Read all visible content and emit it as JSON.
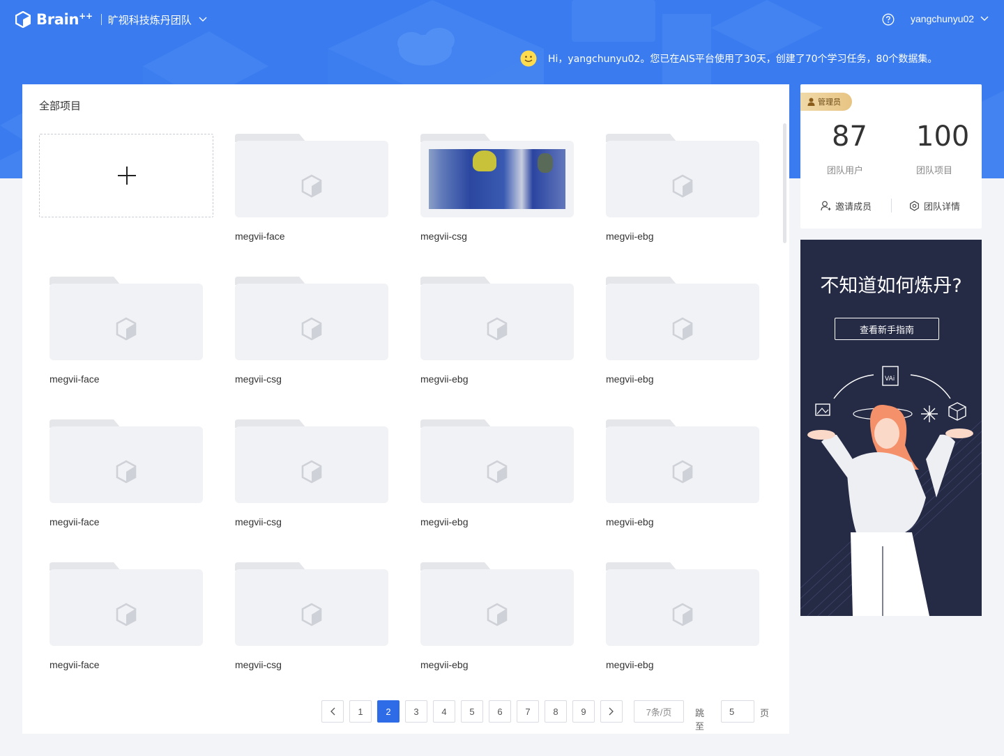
{
  "header": {
    "brand": "Brain",
    "brand_sup": "++",
    "team_name": "旷视科技炼丹团队",
    "username": "yangchunyu02",
    "greeting": "Hi，yangchunyu02。您已在AIS平台使用了30天，创建了70个学习任务，80个数据集。"
  },
  "main": {
    "title": "全部项目",
    "add_label": "",
    "projects": [
      {
        "name": "megvii-face"
      },
      {
        "name": "megvii-csg"
      },
      {
        "name": "megvii-ebg"
      },
      {
        "name": "megvii-face"
      },
      {
        "name": "megvii-csg"
      },
      {
        "name": "megvii-ebg"
      },
      {
        "name": "megvii-ebg"
      },
      {
        "name": "megvii-face"
      },
      {
        "name": "megvii-csg"
      },
      {
        "name": "megvii-ebg"
      },
      {
        "name": "megvii-ebg"
      },
      {
        "name": "megvii-face"
      },
      {
        "name": "megvii-csg"
      },
      {
        "name": "megvii-ebg"
      },
      {
        "name": "megvii-ebg"
      }
    ]
  },
  "pagination": {
    "pages": [
      "1",
      "2",
      "3",
      "4",
      "5",
      "6",
      "7",
      "8",
      "9"
    ],
    "current": "2",
    "page_size": "7条/页",
    "jump_label": "跳至",
    "jump_value": "5",
    "jump_unit": "页"
  },
  "stats": {
    "role_badge": "管理员",
    "users_count": "87",
    "users_label": "团队用户",
    "projects_count": "100",
    "projects_label": "团队项目",
    "invite_label": "邀请成员",
    "details_label": "团队详情"
  },
  "guide": {
    "title": "不知道如何炼丹?",
    "button_label": "查看新手指南"
  },
  "colors": {
    "brand_blue": "#3a7cf0",
    "active_blue": "#2e6be6",
    "guide_bg": "#252a45"
  }
}
